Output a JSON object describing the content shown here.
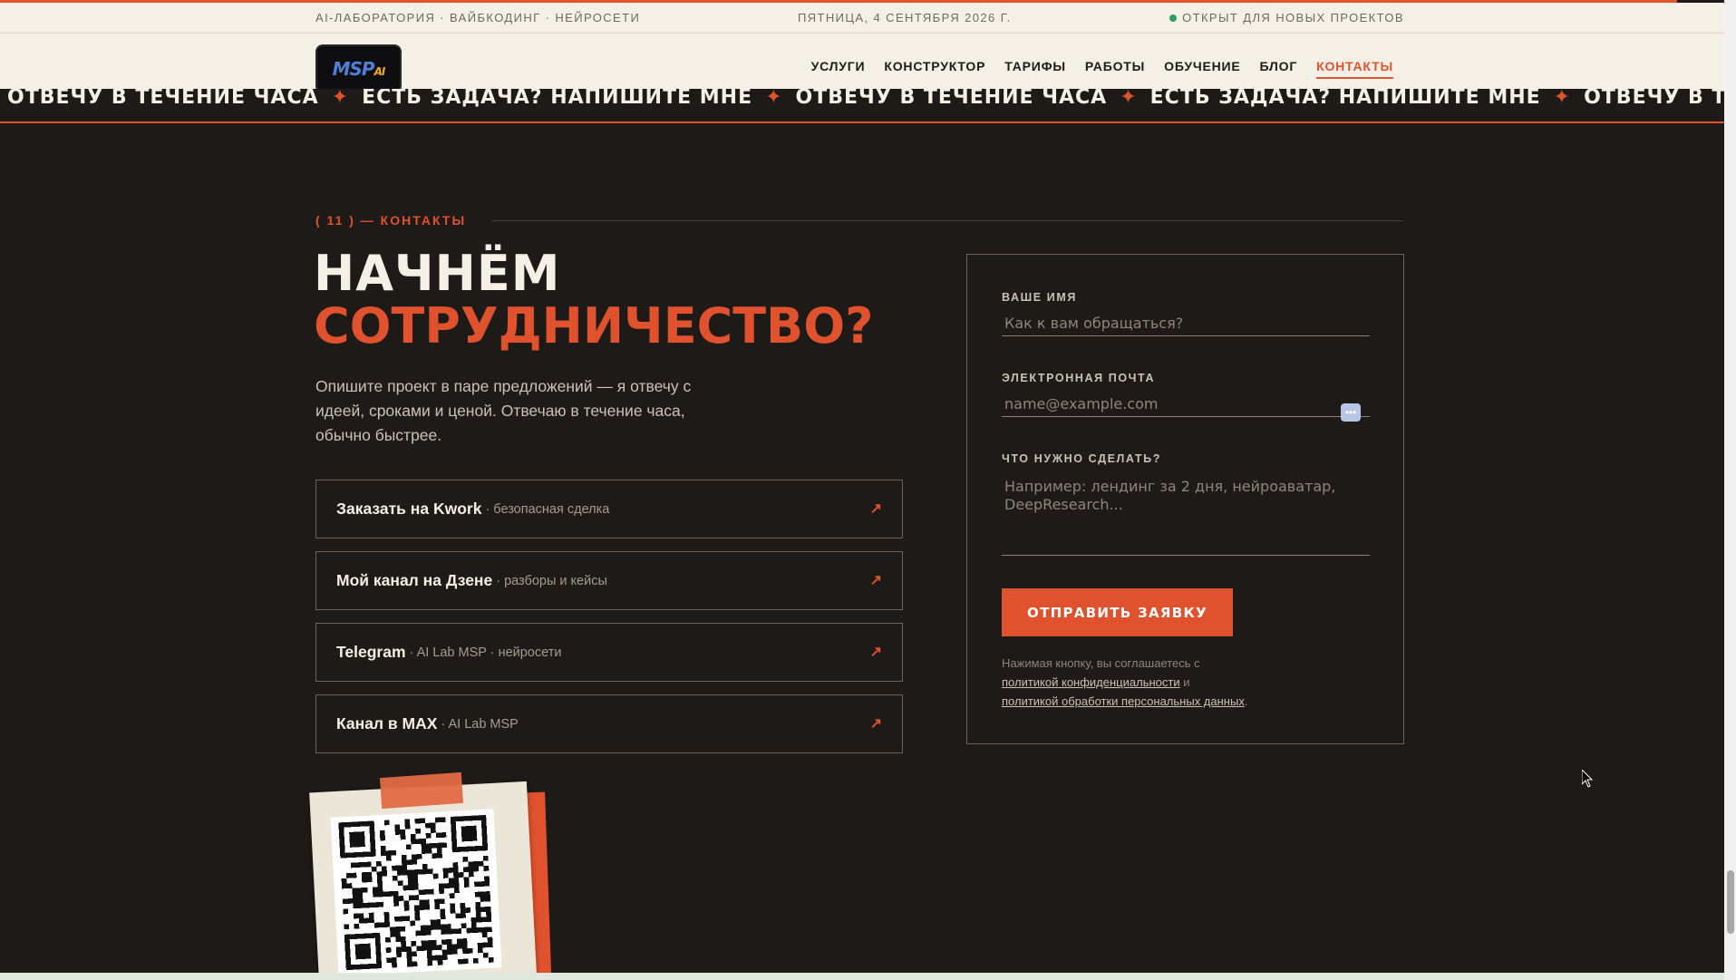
{
  "topbar": {
    "left": "AI-ЛАБОРАТОРИЯ · ВАЙБКОДИНГ · НЕЙРОСЕТИ",
    "date": "ПЯТНИЦА, 4 СЕНТЯБРЯ 2026 Г.",
    "status": "ОТКРЫТ ДЛЯ НОВЫХ ПРОЕКТОВ"
  },
  "logo": {
    "text": "MSP",
    "badge": "AI"
  },
  "nav": [
    {
      "label": "УСЛУГИ"
    },
    {
      "label": "КОНСТРУКТОР"
    },
    {
      "label": "ТАРИФЫ"
    },
    {
      "label": "РАБОТЫ"
    },
    {
      "label": "ОБУЧЕНИЕ"
    },
    {
      "label": "БЛОГ"
    },
    {
      "label": "КОНТАКТЫ",
      "active": true
    }
  ],
  "marquee": {
    "items": [
      "ОТВЕЧУ В ТЕЧЕНИЕ ЧАСА",
      "ЕСТЬ ЗАДАЧА? НАПИШИТЕ МНЕ",
      "ОТВЕЧУ В ТЕЧЕНИЕ ЧАСА",
      "ЕСТЬ ЗАДАЧА? НАПИШИТЕ МНЕ",
      "ОТВЕЧУ В ТЕЧЕНИЕ ЧАСА"
    ],
    "separator": "✦"
  },
  "section": {
    "label": "( 11 ) — КОНТАКТЫ",
    "title_line1": "НАЧНЁМ",
    "title_line2": "СОТРУДНИЧЕСТВО?",
    "lead": "Опишите проект в паре предложений — я отвечу с идеей, сроками и ценой. Отвечаю в течение часа, обычно быстрее."
  },
  "links": [
    {
      "title": "Заказать на Kwork",
      "sub": "· безопасная сделка",
      "arrow": "↗"
    },
    {
      "title": "Мой канал на Дзене",
      "sub": "· разборы и кейсы",
      "arrow": "↗"
    },
    {
      "title": "Telegram",
      "sub": "· AI Lab MSP · нейросети",
      "arrow": "↗"
    },
    {
      "title": "Канал в MAX",
      "sub": "· AI Lab MSP",
      "arrow": "↗"
    }
  ],
  "form": {
    "name_label": "ВАШЕ ИМЯ",
    "name_placeholder": "Как к вам обращаться?",
    "email_label": "ЭЛЕКТРОННАЯ ПОЧТА",
    "email_placeholder": "name@example.com",
    "task_label": "ЧТО НУЖНО СДЕЛАТЬ?",
    "task_placeholder": "Например: лендинг за 2 дня, нейроаватар, DeepResearch...",
    "submit": "ОТПРАВИТЬ ЗАЯВКУ",
    "consent_prefix": "Нажимая кнопку, вы соглашаетесь с",
    "consent_link1": "политикой конфиденциальности",
    "consent_mid": "и",
    "consent_link2": "политикой обработки персональных данных",
    "consent_end": "."
  },
  "colors": {
    "accent": "#e0522d",
    "background_dark": "#1e1a18",
    "background_light": "#f4f0e6",
    "status_green": "#2f9e5b"
  }
}
